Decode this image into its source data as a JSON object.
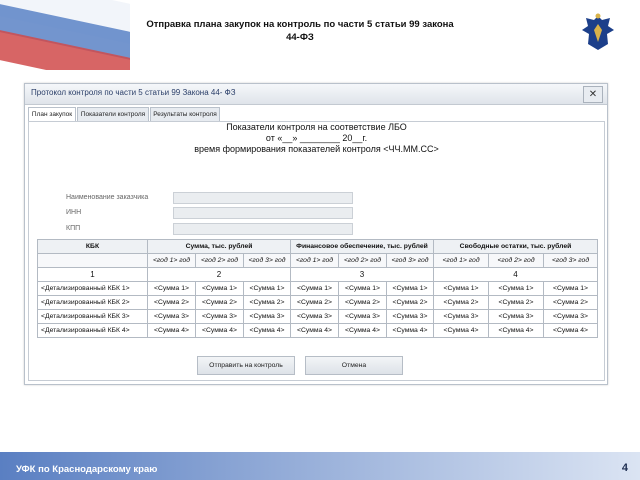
{
  "slide": {
    "title": "Отправка плана закупок на контроль по части 5 статьи 99 закона 44-ФЗ",
    "footer": "УФК по Краснодарскому краю",
    "page_number": "4"
  },
  "window": {
    "title": "Протокол контроля по части 5 статьи 99 Закона 44- ФЗ",
    "close_glyph": "✕"
  },
  "tabs": [
    "План закупок",
    "Показатели контроля",
    "Результаты контроля"
  ],
  "form": {
    "heading_line1": "Показатели контроля на соответствие ЛБО",
    "heading_line2": "от «__» ________ 20__г.",
    "heading_line3": "время формирования показателей контроля <ЧЧ.ММ.СС>",
    "customer_label": "Наименование заказчика",
    "inn_label": "ИНН",
    "kpp_label": "КПП"
  },
  "table": {
    "headers": [
      "КБК",
      "Сумма, тыс. рублей",
      "Финансовое обеспечение, тыс. рублей",
      "Свободные остатки, тыс. рублей"
    ],
    "subheaders": [
      "<год 1> год",
      "<год 2> год",
      "<год 3> год",
      "<год 1> год",
      "<год 2> год",
      "<год 3> год",
      "<год 1> год",
      "<год 2> год",
      "<год 3> год"
    ],
    "numbers": [
      "1",
      "2",
      "3",
      "4"
    ],
    "rows": [
      {
        "kbk": "<Детализированный КБК 1>",
        "values": [
          "<Сумма 1>",
          "<Сумма 1>",
          "<Сумма 1>",
          "<Сумма 1>",
          "<Сумма 1>",
          "<Сумма 1>",
          "<Сумма 1>",
          "<Сумма 1>",
          "<Сумма 1>"
        ]
      },
      {
        "kbk": "<Детализированный КБК 2>",
        "values": [
          "<Сумма 2>",
          "<Сумма 2>",
          "<Сумма 2>",
          "<Сумма 2>",
          "<Сумма 2>",
          "<Сумма 2>",
          "<Сумма 2>",
          "<Сумма 2>",
          "<Сумма 2>"
        ]
      },
      {
        "kbk": "<Детализированный КБК 3>",
        "values": [
          "<Сумма 3>",
          "<Сумма 3>",
          "<Сумма 3>",
          "<Сумма 3>",
          "<Сумма 3>",
          "<Сумма 3>",
          "<Сумма 3>",
          "<Сумма 3>",
          "<Сумма 3>"
        ]
      },
      {
        "kbk": "<Детализированный КБК 4>",
        "values": [
          "<Сумма 4>",
          "<Сумма 4>",
          "<Сумма 4>",
          "<Сумма 4>",
          "<Сумма 4>",
          "<Сумма 4>",
          "<Сумма 4>",
          "<Сумма 4>",
          "<Сумма 4>"
        ]
      }
    ]
  },
  "buttons": {
    "send": "Отправить на контроль",
    "cancel": "Отмена"
  }
}
